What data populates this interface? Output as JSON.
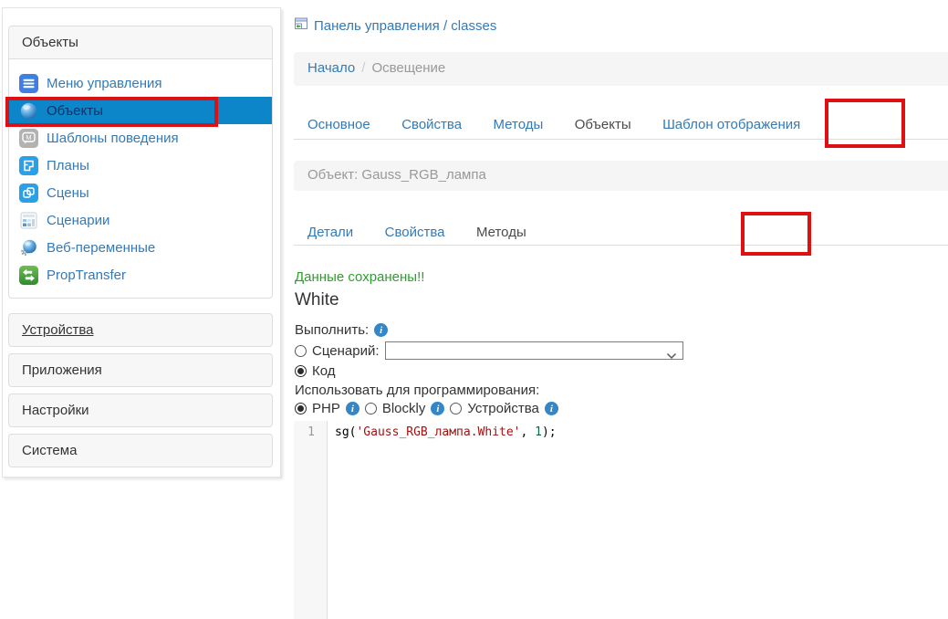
{
  "sidebar": {
    "panel_title": "Объекты",
    "menu_items": [
      {
        "label": "Меню управления"
      },
      {
        "label": "Объекты"
      },
      {
        "label": "Шаблоны поведения"
      },
      {
        "label": "Планы"
      },
      {
        "label": "Сцены"
      },
      {
        "label": "Сценарии"
      },
      {
        "label": "Веб-переменные"
      },
      {
        "label": "PropTransfer"
      }
    ],
    "active_item": "Объекты",
    "sections": [
      {
        "label": "Устройства"
      },
      {
        "label": "Приложения"
      },
      {
        "label": "Настройки"
      },
      {
        "label": "Система"
      }
    ]
  },
  "header": {
    "app_link": "Панель управления / classes",
    "breadcrumb": {
      "home": "Начало",
      "separator": "/",
      "current": "Освещение"
    }
  },
  "tabs": {
    "items": [
      {
        "label": "Основное"
      },
      {
        "label": "Свойства"
      },
      {
        "label": "Методы"
      },
      {
        "label": "Объекты"
      },
      {
        "label": "Шаблон отображения"
      }
    ],
    "active": "Объекты"
  },
  "object_bar": {
    "label": "Объект: Gauss_RGB_лампа"
  },
  "subtabs": {
    "items": [
      {
        "label": "Детали"
      },
      {
        "label": "Свойства"
      },
      {
        "label": "Методы"
      }
    ],
    "active": "Методы"
  },
  "method_form": {
    "saved_message": "Данные сохранены!!",
    "method_title": "White",
    "execute_label": "Выполнить:",
    "scenario_label": "Сценарий:",
    "scenario_value": "",
    "code_label": "Код",
    "execute_mode": "Код",
    "programming_label": "Использовать для программирования:",
    "languages": [
      {
        "label": "PHP"
      },
      {
        "label": "Blockly"
      },
      {
        "label": "Устройства"
      }
    ],
    "selected_language": "PHP"
  },
  "code_editor": {
    "line_number": "1",
    "code": {
      "fn": "sg(",
      "string": "'Gauss_RGB_лампа.White'",
      "sep": ", ",
      "number": "1",
      "end": ");"
    }
  },
  "colors": {
    "link_blue": "#337ab7",
    "active_item_bg": "#0c86c8",
    "active_item_text": "#0d3268",
    "annotation_red": "#dd1111",
    "success_green": "#2e9e2e",
    "string_red": "#a11111",
    "number_green": "#116644",
    "bar_gray": "#f5f5f5"
  }
}
